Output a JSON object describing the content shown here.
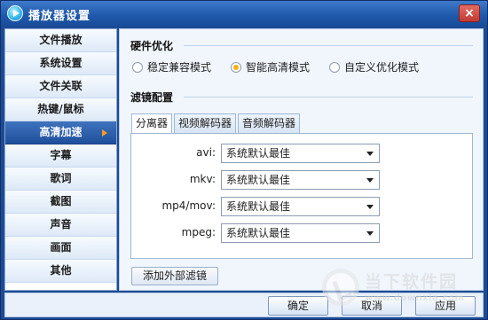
{
  "window": {
    "title": "播放器设置",
    "close_label": "×"
  },
  "sidebar": {
    "items": [
      {
        "label": "文件播放",
        "active": false
      },
      {
        "label": "系统设置",
        "active": false
      },
      {
        "label": "文件关联",
        "active": false
      },
      {
        "label": "热键/鼠标",
        "active": false
      },
      {
        "label": "高清加速",
        "active": true
      },
      {
        "label": "字幕",
        "active": false
      },
      {
        "label": "歌词",
        "active": false
      },
      {
        "label": "截图",
        "active": false
      },
      {
        "label": "声音",
        "active": false
      },
      {
        "label": "画面",
        "active": false
      },
      {
        "label": "其他",
        "active": false
      }
    ]
  },
  "hardware": {
    "title": "硬件优化",
    "options": [
      {
        "label": "稳定兼容模式",
        "checked": false
      },
      {
        "label": "智能高清模式",
        "checked": true
      },
      {
        "label": "自定义优化模式",
        "checked": false
      }
    ]
  },
  "filters": {
    "title": "滤镜配置",
    "tabs": [
      {
        "label": "分离器",
        "active": true
      },
      {
        "label": "视频解码器",
        "active": false
      },
      {
        "label": "音频解码器",
        "active": false
      }
    ],
    "rows": [
      {
        "label": "avi:",
        "value": "系统默认最佳"
      },
      {
        "label": "mkv:",
        "value": "系统默认最佳"
      },
      {
        "label": "mp4/mov:",
        "value": "系统默认最佳"
      },
      {
        "label": "mpeg:",
        "value": "系统默认最佳"
      }
    ],
    "add_button": "添加外部滤镜"
  },
  "footer": {
    "ok": "确定",
    "cancel": "取消",
    "apply": "应用"
  },
  "watermark": {
    "main": "当下软件园",
    "sub": "www.downxia.com"
  },
  "colors": {
    "titlebar": "#205aad",
    "accent": "#f0b21a",
    "active_item": "#2a5aa6"
  }
}
